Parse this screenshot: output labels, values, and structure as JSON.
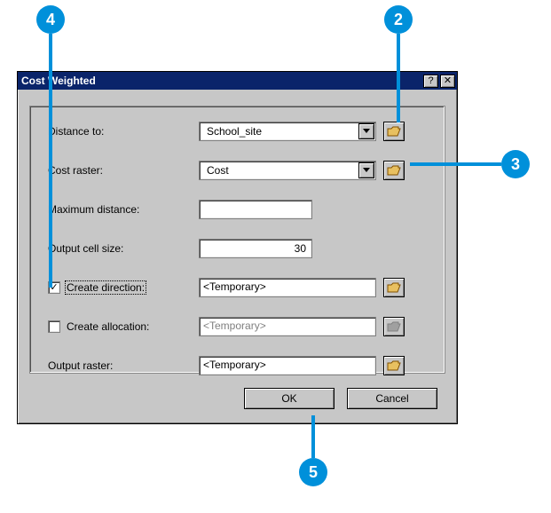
{
  "title": "Cost Weighted",
  "labels": {
    "distance_to": "Distance to:",
    "cost_raster": "Cost raster:",
    "max_distance": "Maximum distance:",
    "output_cell": "Output cell size:",
    "create_direction": "Create direction:",
    "create_allocation": "Create allocation:",
    "output_raster": "Output raster:"
  },
  "fields": {
    "distance_to": {
      "value": "School_site"
    },
    "cost_raster": {
      "value": "Cost"
    },
    "max_distance": {
      "value": ""
    },
    "output_cell": {
      "value": "30"
    },
    "create_direction": {
      "checked": true,
      "value": "<Temporary>"
    },
    "create_allocation": {
      "checked": false,
      "value": "<Temporary>"
    },
    "output_raster": {
      "value": "<Temporary>"
    }
  },
  "buttons": {
    "ok": "OK",
    "cancel": "Cancel"
  },
  "callouts": {
    "c2": "2",
    "c3": "3",
    "c4": "4",
    "c5": "5"
  }
}
